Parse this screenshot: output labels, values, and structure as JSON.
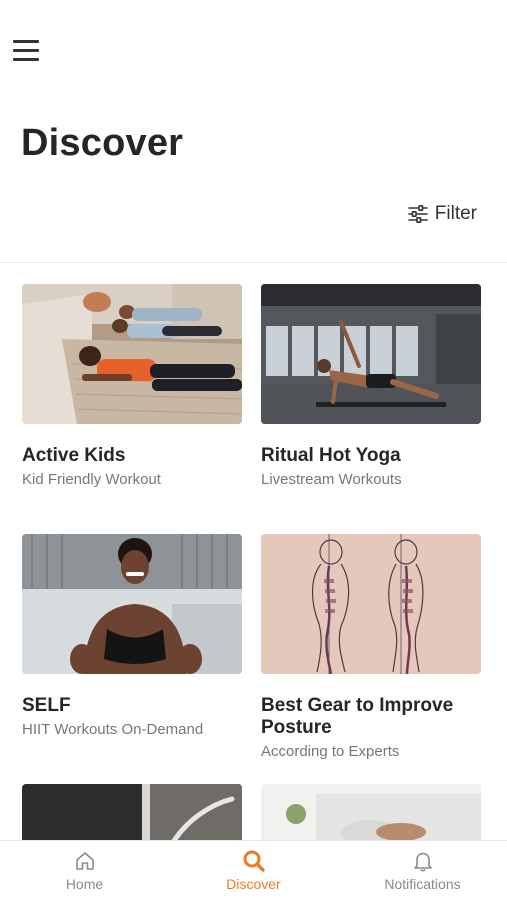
{
  "header": {
    "menu_icon": "hamburger-menu-icon",
    "title": "Discover",
    "filter_label": "Filter",
    "filter_icon": "sliders-icon"
  },
  "cards": [
    {
      "title": "Active Kids",
      "subtitle": "Kid Friendly Workout"
    },
    {
      "title": "Ritual Hot Yoga",
      "subtitle": "Livestream Workouts"
    },
    {
      "title": "SELF",
      "subtitle": "HIIT Workouts On-Demand"
    },
    {
      "title": "Best Gear to Improve Posture",
      "subtitle": "According to Experts"
    },
    {
      "title": "",
      "subtitle": ""
    },
    {
      "title": "",
      "subtitle": ""
    }
  ],
  "tabbar": {
    "items": [
      {
        "label": "Home",
        "icon": "home-icon",
        "active": false
      },
      {
        "label": "Discover",
        "icon": "search-icon",
        "active": true
      },
      {
        "label": "Notifications",
        "icon": "bell-icon",
        "active": false
      }
    ]
  },
  "colors": {
    "accent": "#f07a21",
    "text": "#262626",
    "muted": "#777777",
    "tab_inactive": "#8a8a8a"
  }
}
